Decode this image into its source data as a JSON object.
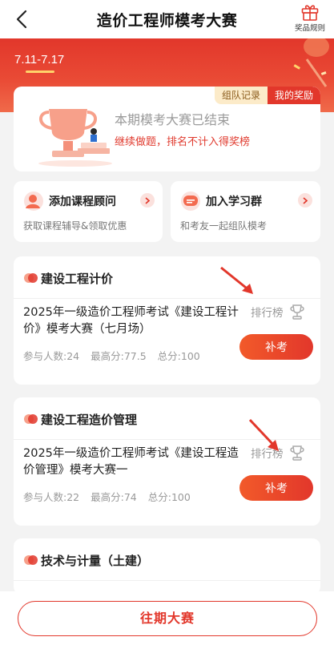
{
  "nav": {
    "title": "造价工程师模考大赛",
    "rules_label": "奖品规则"
  },
  "hero": {
    "date_tab": "7.11-7.17"
  },
  "result": {
    "chip_team": "组队记录",
    "chip_reward": "我的奖励",
    "title": "本期模考大赛已结束",
    "subtitle": "继续做题，排名不计入得奖榜"
  },
  "promos": [
    {
      "title": "添加课程顾问",
      "subtitle": "获取课程辅导&领取优惠"
    },
    {
      "title": "加入学习群",
      "subtitle": "和考友一起组队模考"
    }
  ],
  "sections": [
    {
      "title": "建设工程计价",
      "exam_name": "2025年一级造价工程师考试《建设工程计价》模考大赛（七月场）",
      "participants": "参与人数:24",
      "high_score": "最高分:77.5",
      "total_score": "总分:100",
      "rank_label": "排行榜",
      "action_label": "补考"
    },
    {
      "title": "建设工程造价管理",
      "exam_name": "2025年一级造价工程师考试《建设工程造价管理》模考大赛一",
      "participants": "参与人数:22",
      "high_score": "最高分:74",
      "total_score": "总分:100",
      "rank_label": "排行榜",
      "action_label": "补考"
    },
    {
      "title": "技术与计量（土建）"
    }
  ],
  "bottom": {
    "past_label": "往期大赛"
  },
  "colors": {
    "brand_red": "#e2372b",
    "orange": "#f25a2a",
    "gold": "#ffd36a"
  }
}
